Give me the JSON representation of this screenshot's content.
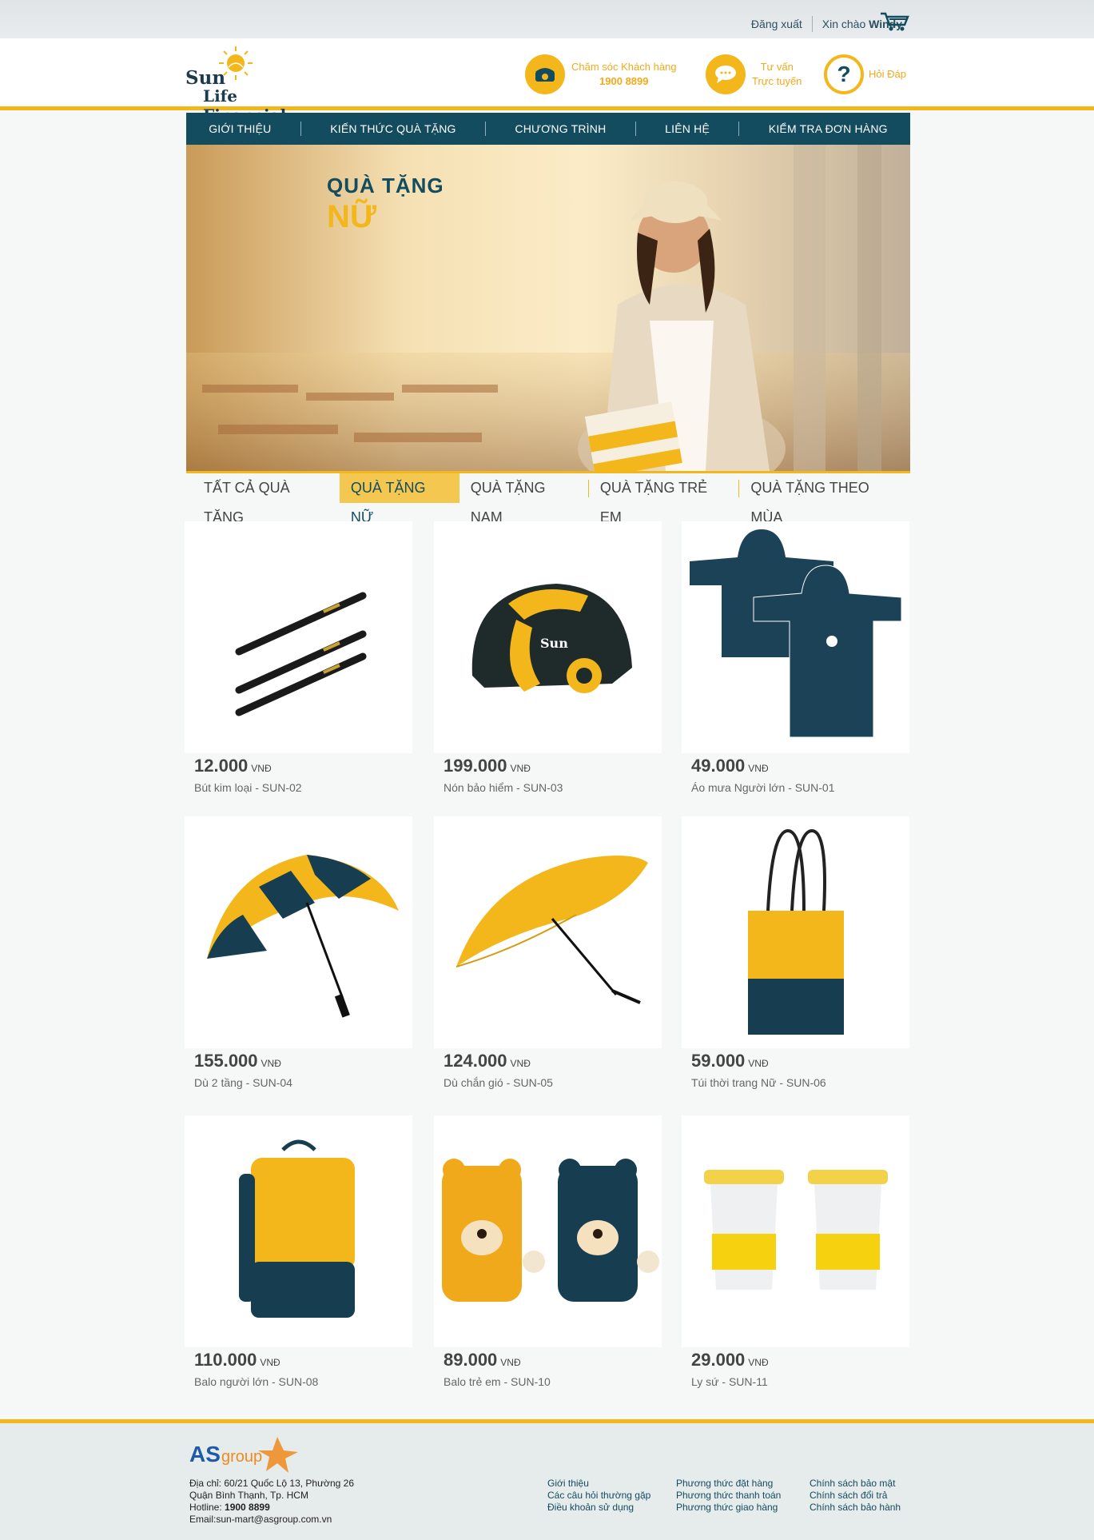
{
  "topbar": {
    "logout": "Đăng xuất",
    "greeting": "Xin chào",
    "user": "Windy"
  },
  "header": {
    "logo_line1": "Sun",
    "logo_line2": "Life Financial",
    "support_label": "Chăm sóc Khách hàng",
    "support_phone": "1900 8899",
    "advice_line1": "Tư vấn",
    "advice_line2": "Trực tuyến",
    "faq": "Hỏi Đáp"
  },
  "nav": [
    "GIỚI THIỆU",
    "KIẾN THỨC QUÀ TẶNG",
    "CHƯƠNG TRÌNH",
    "LIÊN HỆ",
    "KIỂM TRA ĐƠN HÀNG"
  ],
  "banner": {
    "line1": "QUÀ TẶNG",
    "line2": "NỮ"
  },
  "tabs": [
    "TẤT CẢ QUÀ TẶNG",
    "QUÀ TẶNG NỮ",
    "QUÀ TẶNG NAM",
    "QUÀ TẶNG TRẺ EM",
    "QUÀ TẶNG THEO MÙA"
  ],
  "currency": "VNĐ",
  "products": [
    {
      "price": "12.000",
      "name": "Bút kim loại - SUN-02",
      "icon": "pens"
    },
    {
      "price": "199.000",
      "name": "Nón bảo hiểm - SUN-03",
      "icon": "helmet"
    },
    {
      "price": "49.000",
      "name": "Áo mưa Người lớn - SUN-01",
      "icon": "raincoat"
    },
    {
      "price": "155.000",
      "name": "Dù 2 tầng - SUN-04",
      "icon": "umbrella-double"
    },
    {
      "price": "124.000",
      "name": "Dù chắn gió - SUN-05",
      "icon": "umbrella-wind"
    },
    {
      "price": "59.000",
      "name": "Túi thời trang Nữ - SUN-06",
      "icon": "tote-bag"
    },
    {
      "price": "110.000",
      "name": "Balo người lớn - SUN-08",
      "icon": "backpack"
    },
    {
      "price": "89.000",
      "name": "Balo trẻ em - SUN-10",
      "icon": "kids-backpack"
    },
    {
      "price": "29.000",
      "name": "Ly sứ - SUN-11",
      "icon": "mugs"
    }
  ],
  "footer": {
    "logo": "AS group",
    "address1": "Địa chỉ: 60/21 Quốc Lộ 13, Phường 26",
    "address2": "Quận Bình Thạnh, Tp. HCM",
    "hotline_label": "Hotline:",
    "hotline": "1900 8899",
    "email": "Email:sun-mart@asgroup.com.vn",
    "col1": [
      "Giới thiệu",
      "Các câu hỏi thường gặp",
      "Điều khoản sử dụng"
    ],
    "col2": [
      "Phương thức đặt hàng",
      "Phương thức thanh toán",
      "Phương thức giao hàng"
    ],
    "col3": [
      "Chính sách bảo mật",
      "Chính sách đổi trả",
      "Chính sách bảo hành"
    ]
  },
  "colors": {
    "brand_navy": "#134c5e",
    "brand_yellow": "#f3b71b"
  }
}
